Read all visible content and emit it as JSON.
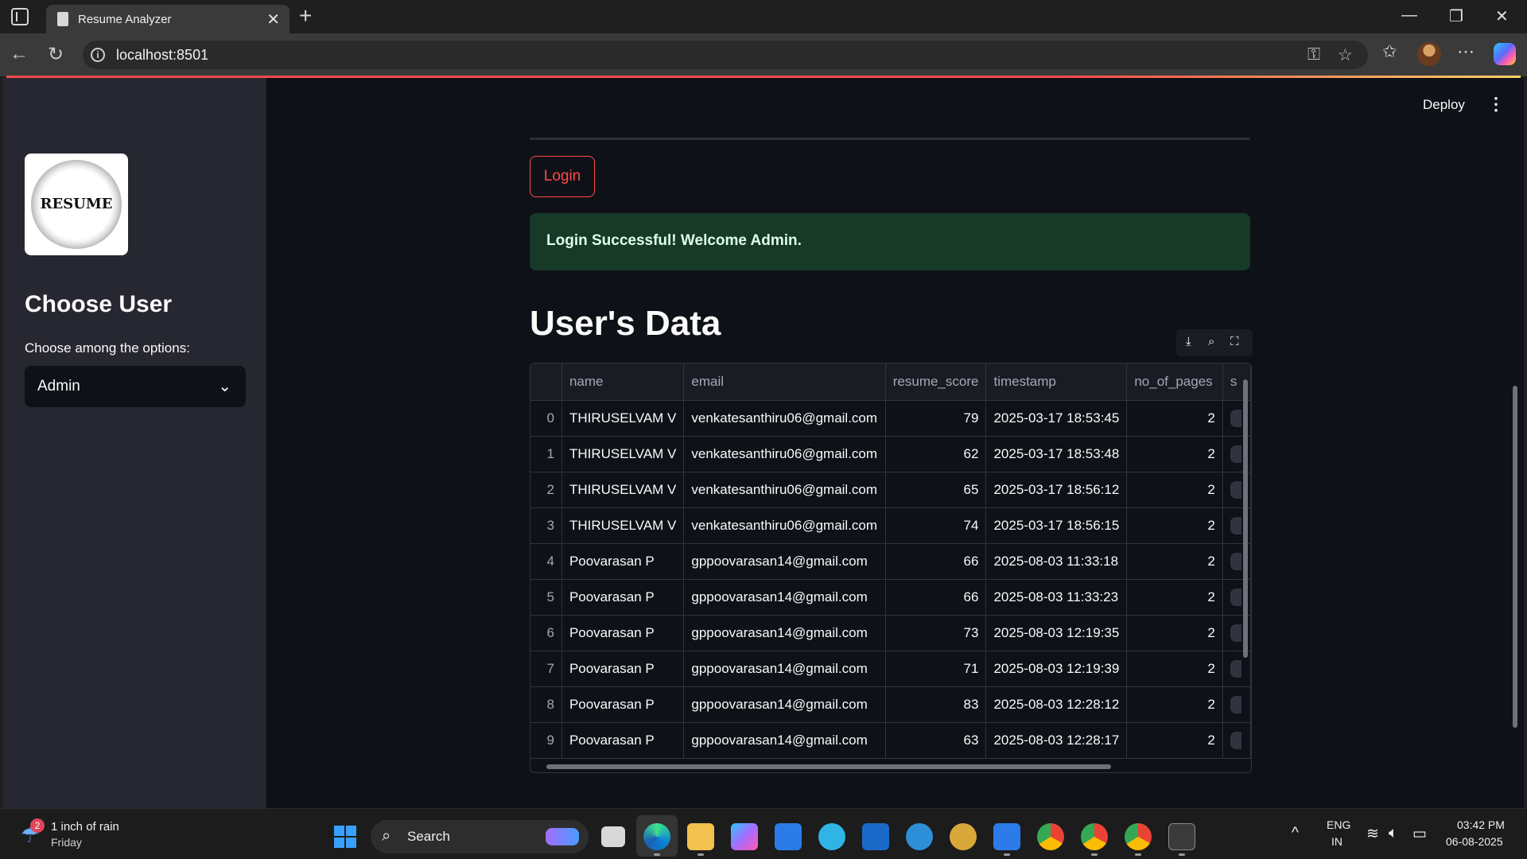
{
  "browser": {
    "tab_title": "Resume Analyzer",
    "tab_close": "✕",
    "new_tab": "+",
    "url": "localhost:8501",
    "minimize": "—",
    "maximize": "❐",
    "close": "✕"
  },
  "sidebar": {
    "logo_text": "RESUME",
    "heading": "Choose User",
    "select_label": "Choose among the options:",
    "select_value": "Admin"
  },
  "header": {
    "deploy": "Deploy",
    "menu": "⋮"
  },
  "main": {
    "login_button": "Login",
    "alert_text": "Login Successful! Welcome Admin.",
    "section_heading": "User's Data"
  },
  "dataframe": {
    "columns": [
      "",
      "name",
      "email",
      "resume_score",
      "timestamp",
      "no_of_pages",
      "s"
    ],
    "rows": [
      [
        "0",
        "THIRUSELVAM V",
        "venkatesanthiru06@gmail.com",
        "79",
        "2025-03-17 18:53:45",
        "2"
      ],
      [
        "1",
        "THIRUSELVAM V",
        "venkatesanthiru06@gmail.com",
        "62",
        "2025-03-17 18:53:48",
        "2"
      ],
      [
        "2",
        "THIRUSELVAM V",
        "venkatesanthiru06@gmail.com",
        "65",
        "2025-03-17 18:56:12",
        "2"
      ],
      [
        "3",
        "THIRUSELVAM V",
        "venkatesanthiru06@gmail.com",
        "74",
        "2025-03-17 18:56:15",
        "2"
      ],
      [
        "4",
        "Poovarasan P",
        "gppoovarasan14@gmail.com",
        "66",
        "2025-08-03 11:33:18",
        "2"
      ],
      [
        "5",
        "Poovarasan P",
        "gppoovarasan14@gmail.com",
        "66",
        "2025-08-03 11:33:23",
        "2"
      ],
      [
        "6",
        "Poovarasan P",
        "gppoovarasan14@gmail.com",
        "73",
        "2025-08-03 12:19:35",
        "2"
      ],
      [
        "7",
        "Poovarasan P",
        "gppoovarasan14@gmail.com",
        "71",
        "2025-08-03 12:19:39",
        "2"
      ],
      [
        "8",
        "Poovarasan P",
        "gppoovarasan14@gmail.com",
        "83",
        "2025-08-03 12:28:12",
        "2"
      ],
      [
        "9",
        "Poovarasan P",
        "gppoovarasan14@gmail.com",
        "63",
        "2025-08-03 12:28:17",
        "2"
      ]
    ]
  },
  "taskbar": {
    "weather_badge": "2",
    "weather": "1 inch of rain",
    "weather_day": "Friday",
    "search": "Search",
    "lang": "ENG",
    "region": "IN",
    "time": "03:42 PM",
    "date": "06-08-2025"
  },
  "colors": {
    "accent": "#ff4b4b",
    "app_background": "#0e1117",
    "sidebar_background": "#262730",
    "success_background": "#173928"
  }
}
